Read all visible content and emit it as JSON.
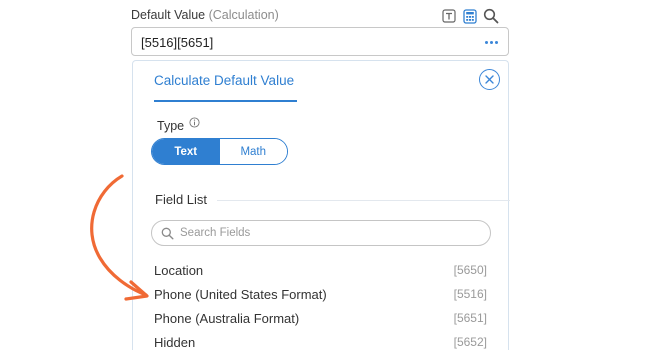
{
  "field": {
    "label": "Default Value",
    "label_suffix": "(Calculation)",
    "value": "[5516][5651]"
  },
  "icons": {
    "text": "text-icon",
    "calculator": "calculator-icon",
    "search": "search-icon",
    "more": "more-dots-icon",
    "close": "close-icon",
    "info": "info-icon",
    "arrow": "curved-arrow-annotation"
  },
  "panel": {
    "tab_label": "Calculate Default Value",
    "type_label": "Type",
    "type_options": [
      "Text",
      "Math"
    ],
    "type_selected": "Text",
    "field_list_title": "Field List",
    "search_placeholder": "Search Fields",
    "fields": [
      {
        "name": "Location",
        "id": "[5650]"
      },
      {
        "name": "Phone (United States Format)",
        "id": "[5516]"
      },
      {
        "name": "Phone (Australia Format)",
        "id": "[5651]"
      },
      {
        "name": "Hidden",
        "id": "[5652]"
      }
    ]
  },
  "colors": {
    "accent": "#2f7fd1",
    "annotation": "#f06a35"
  }
}
